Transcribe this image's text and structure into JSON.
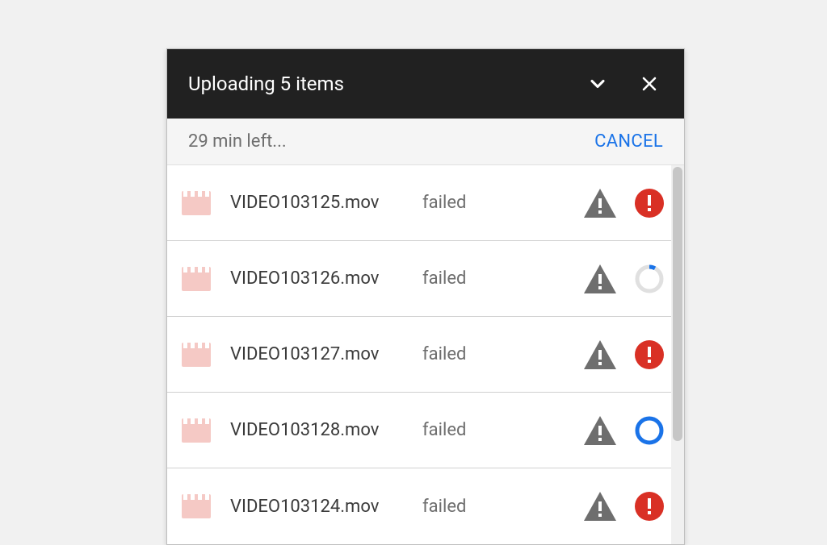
{
  "header": {
    "title": "Uploading 5 items"
  },
  "subheader": {
    "time_left": "29 min left...",
    "cancel_label": "CANCEL"
  },
  "colors": {
    "accent_blue": "#1a73e8",
    "error_red": "#d93025",
    "warn_gray": "#6e6e6e",
    "file_pink": "#f5c9c5",
    "ring_gray": "#e0e0e0"
  },
  "items": [
    {
      "filename": "VIDEO103125.mov",
      "status": "failed",
      "indicator": "error"
    },
    {
      "filename": "VIDEO103126.mov",
      "status": "failed",
      "indicator": "progress_gray"
    },
    {
      "filename": "VIDEO103127.mov",
      "status": "failed",
      "indicator": "error"
    },
    {
      "filename": "VIDEO103128.mov",
      "status": "failed",
      "indicator": "progress_blue"
    },
    {
      "filename": "VIDEO103124.mov",
      "status": "failed",
      "indicator": "error"
    }
  ]
}
